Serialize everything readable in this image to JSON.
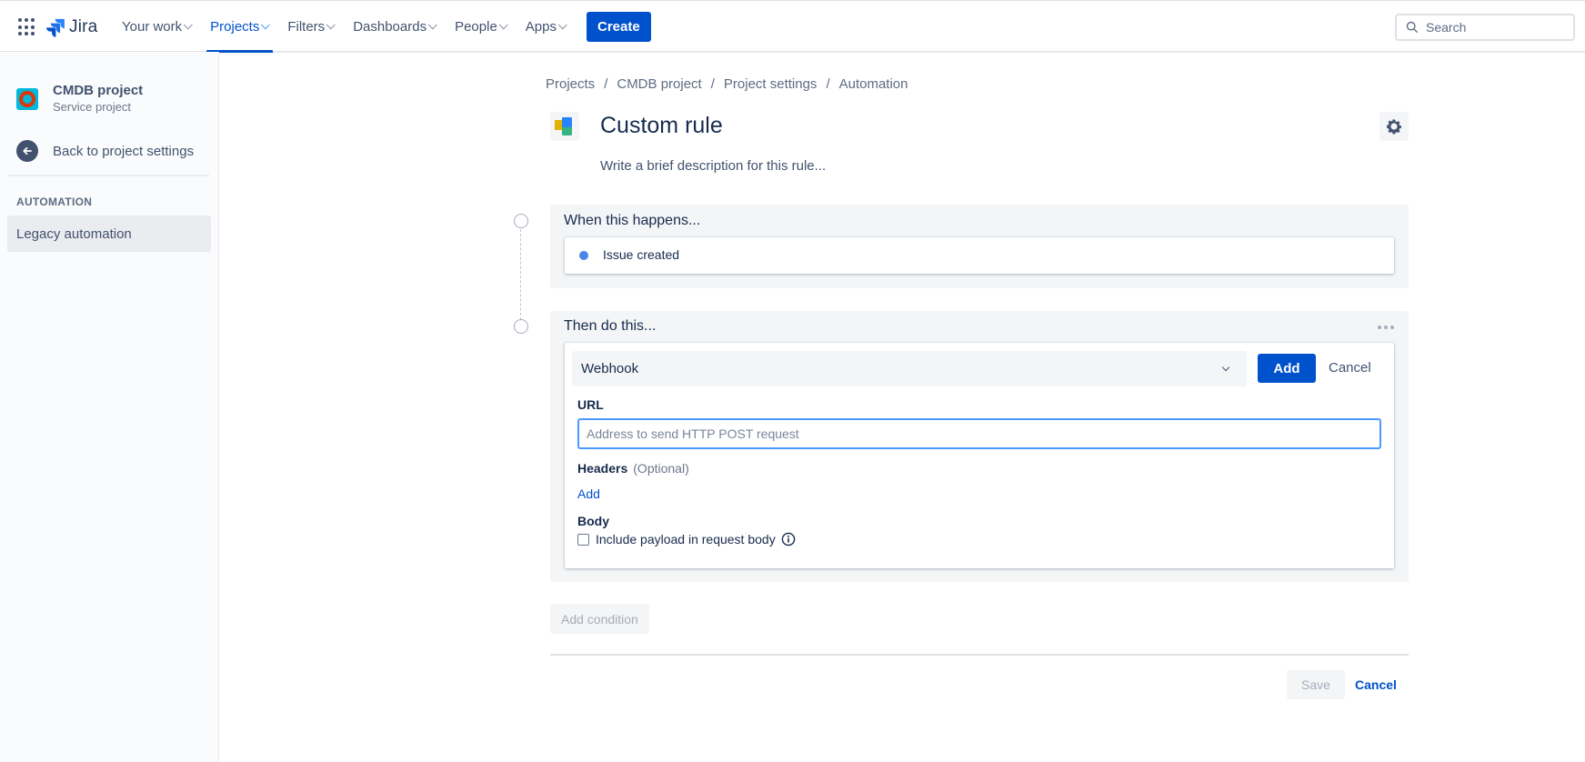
{
  "topnav": {
    "product": "Jira",
    "items": [
      {
        "label": "Your work",
        "active": false
      },
      {
        "label": "Projects",
        "active": true
      },
      {
        "label": "Filters",
        "active": false
      },
      {
        "label": "Dashboards",
        "active": false
      },
      {
        "label": "People",
        "active": false
      },
      {
        "label": "Apps",
        "active": false
      }
    ],
    "create_label": "Create",
    "search_placeholder": "Search",
    "accent": "#0052cc"
  },
  "sidebar": {
    "project_name": "CMDB project",
    "project_type": "Service project",
    "back_label": "Back to project settings",
    "section_heading": "AUTOMATION",
    "items": [
      {
        "label": "Legacy automation",
        "selected": true
      }
    ]
  },
  "breadcrumb": [
    "Projects",
    "CMDB project",
    "Project settings",
    "Automation"
  ],
  "rule": {
    "title": "Custom rule",
    "description_placeholder": "Write a brief description for this rule..."
  },
  "trigger": {
    "heading": "When this happens...",
    "item": "Issue created",
    "dot_color": "#4a86e8"
  },
  "action": {
    "heading": "Then do this...",
    "selected_action": "Webhook",
    "add_label": "Add",
    "cancel_label": "Cancel",
    "url_label": "URL",
    "url_value": "",
    "url_placeholder": "Address to send HTTP POST request",
    "headers_label": "Headers",
    "headers_optional": "(Optional)",
    "headers_add_link": "Add",
    "body_label": "Body",
    "payload_checkbox_label": "Include payload in request body",
    "payload_checked": false
  },
  "footer": {
    "add_condition_label": "Add condition",
    "save_label": "Save",
    "cancel_label": "Cancel"
  }
}
